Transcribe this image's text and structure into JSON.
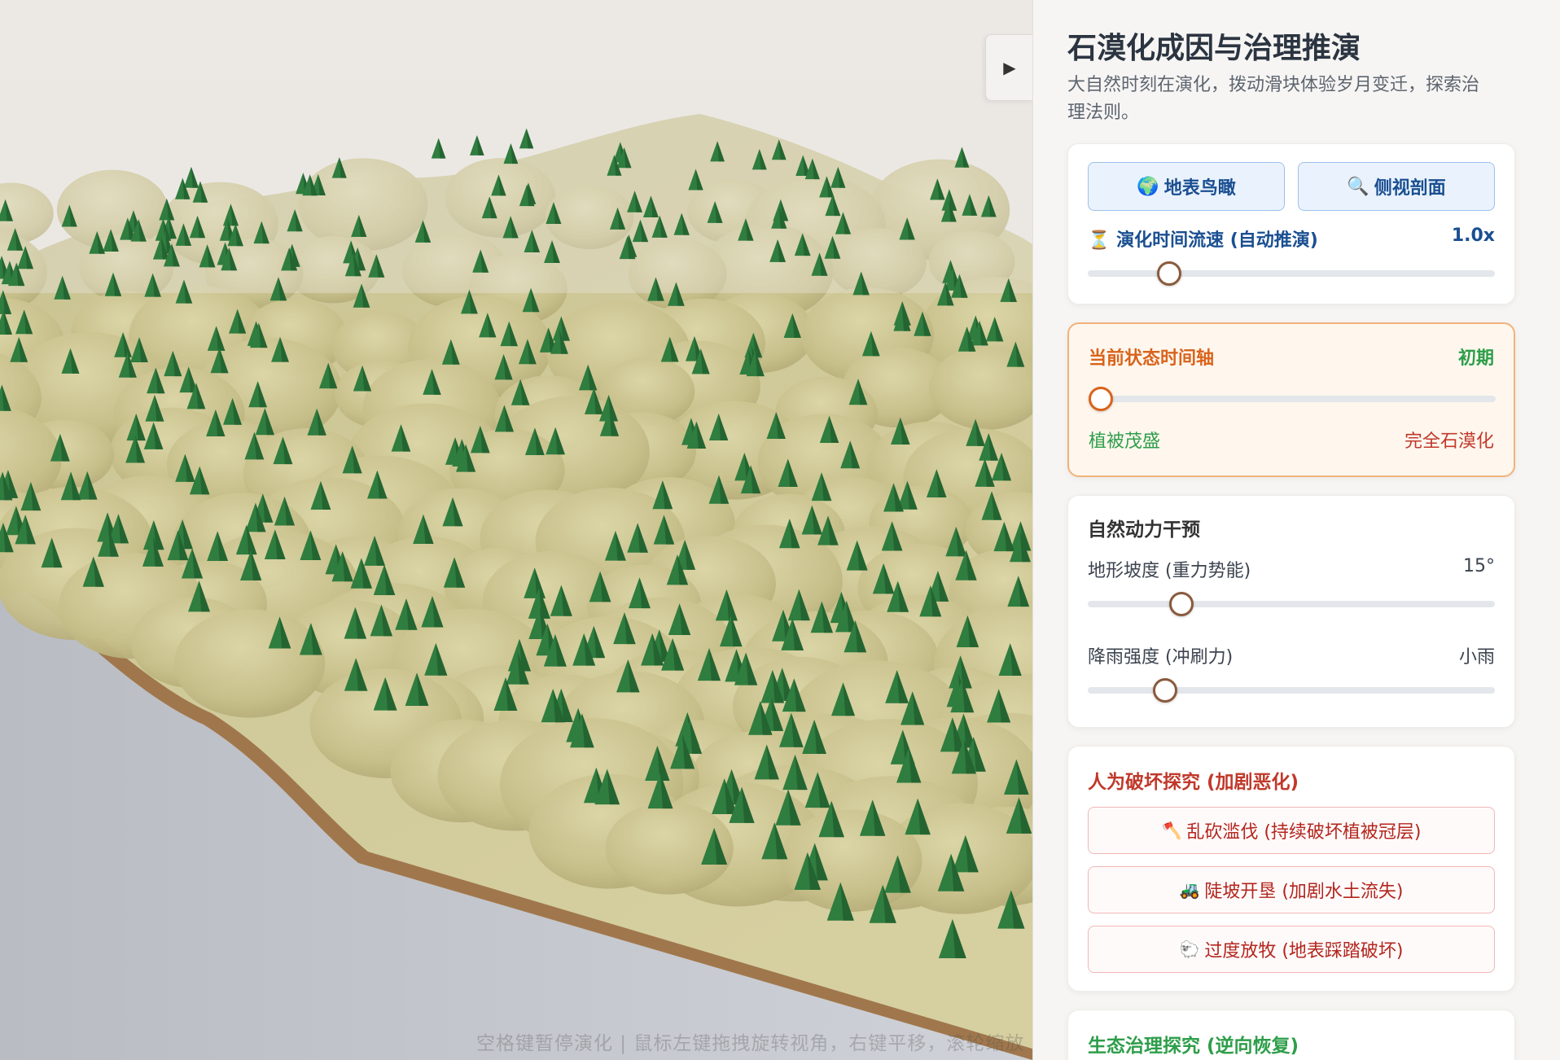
{
  "panel": {
    "title": "石漠化成因与治理推演",
    "description": "大自然时刻在演化，拨动滑块体验岁月变迁，探索治理法则。",
    "toggle_icon": "▶"
  },
  "view_controls": {
    "aerial_icon": "🌍",
    "aerial_label": "地表鸟瞰",
    "side_icon": "🔍",
    "side_label": "侧视剖面",
    "speed_icon": "⏳",
    "speed_label": "演化时间流速 (自动推演)",
    "speed_value": "1.0x",
    "speed_fraction": 0.2
  },
  "timeline": {
    "title": "当前状态时间轴",
    "stage": "初期",
    "fraction": 0.03,
    "start_label": "植被茂盛",
    "end_label": "完全石漠化"
  },
  "natural": {
    "title": "自然动力干预",
    "slope_label": "地形坡度 (重力势能)",
    "slope_value": "15°",
    "slope_fraction": 0.23,
    "rain_label": "降雨强度 (冲刷力)",
    "rain_value": "小雨",
    "rain_fraction": 0.19
  },
  "human": {
    "title": "人为破坏探究 (加剧恶化)",
    "buttons": [
      {
        "icon": "🪓",
        "label": "乱砍滥伐 (持续破坏植被冠层)"
      },
      {
        "icon": "🚜",
        "label": "陡坡开垦 (加剧水土流失)"
      },
      {
        "icon": "🐑",
        "label": "过度放牧 (地表踩踏破坏)"
      }
    ]
  },
  "restore": {
    "title": "生态治理探究 (逆向恢复)"
  },
  "hint": "空格键暂停演化 | 鼠标左键拖拽旋转视角，右键平移，滚轮缩放",
  "colors": {
    "accent_blue": "#1a4f91",
    "warn_orange": "#d9631b",
    "lush_green": "#2e9e4a",
    "danger_red": "#c0392b",
    "terrain": "#cfc896",
    "tree": "#2f7d3f"
  }
}
